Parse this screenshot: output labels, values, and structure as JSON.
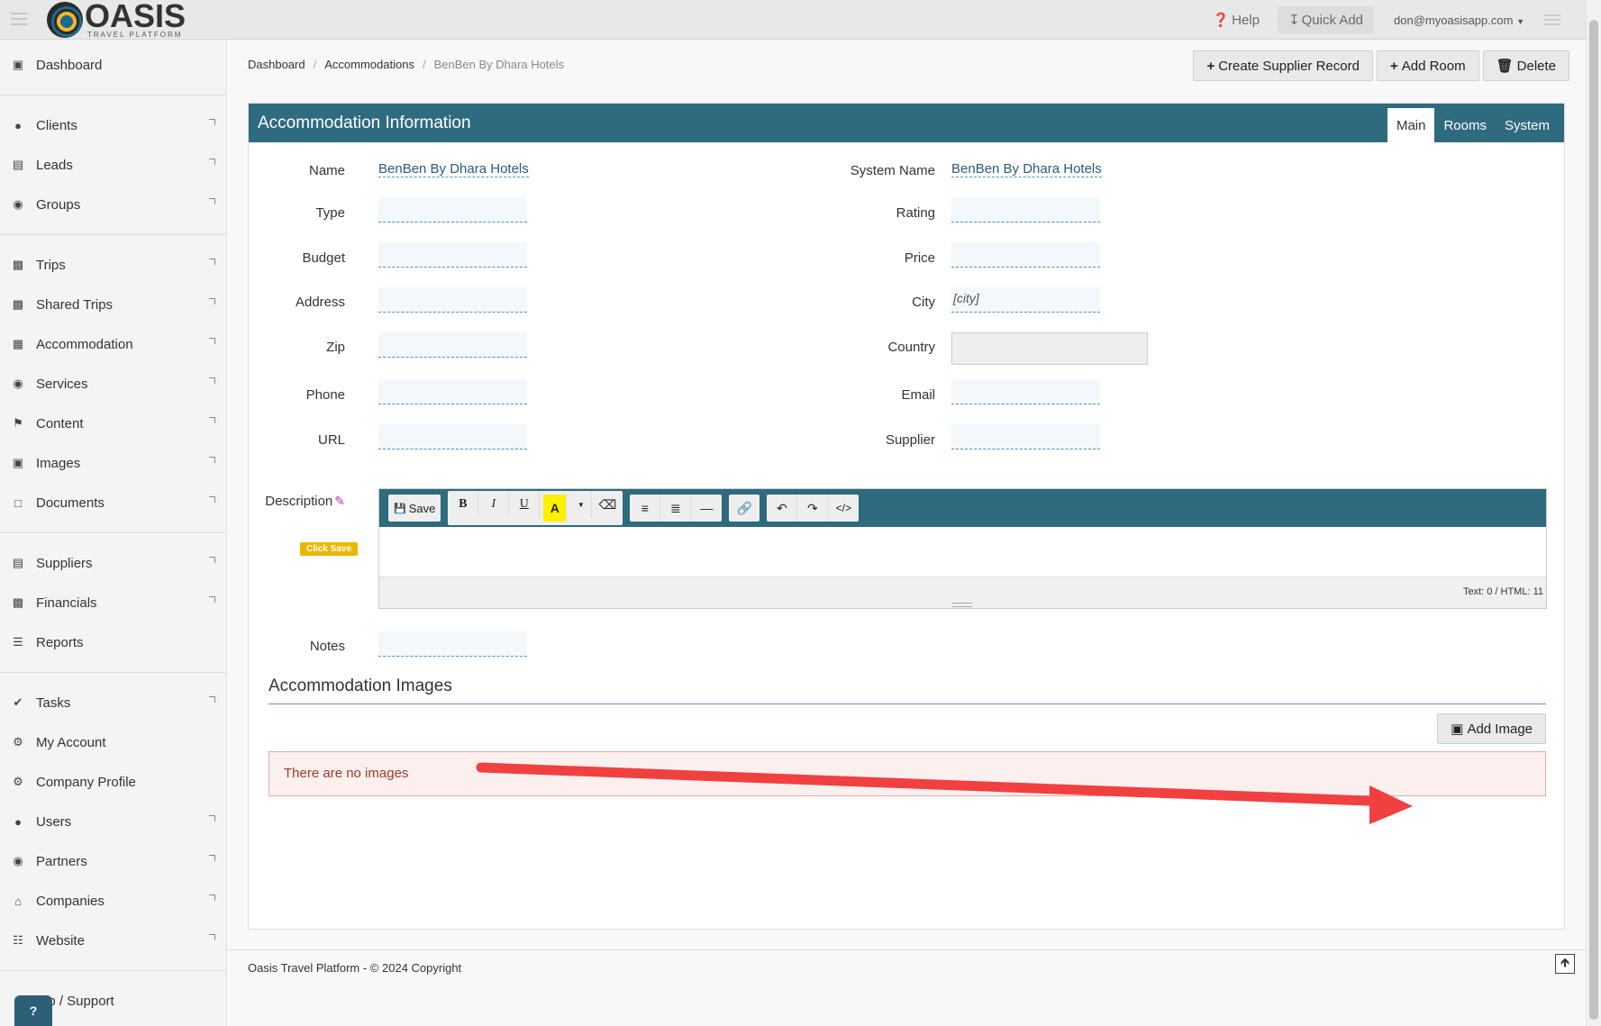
{
  "topbar": {
    "logo_title": "OASIS",
    "logo_sub": "TRAVEL PLATFORM",
    "help": "Help",
    "quick_add": "Quick Add",
    "user": "don@myoasisapp.com"
  },
  "sidebar": {
    "items": [
      {
        "label": "Dashboard",
        "icon": "monitor-icon"
      },
      {
        "label": "Clients",
        "icon": "user-icon"
      },
      {
        "label": "Leads",
        "icon": "inbox-icon"
      },
      {
        "label": "Groups",
        "icon": "users-icon"
      },
      {
        "label": "Trips",
        "icon": "suitcase-icon"
      },
      {
        "label": "Shared Trips",
        "icon": "suitcase-icon"
      },
      {
        "label": "Accommodation",
        "icon": "building-icon"
      },
      {
        "label": "Services",
        "icon": "binoculars-icon"
      },
      {
        "label": "Content",
        "icon": "flag-icon"
      },
      {
        "label": "Images",
        "icon": "image-icon"
      },
      {
        "label": "Documents",
        "icon": "pdf-icon"
      },
      {
        "label": "Suppliers",
        "icon": "server-icon"
      },
      {
        "label": "Financials",
        "icon": "money-icon"
      },
      {
        "label": "Reports",
        "icon": "list-icon"
      },
      {
        "label": "Tasks",
        "icon": "check-icon"
      },
      {
        "label": "My Account",
        "icon": "gear-icon"
      },
      {
        "label": "Company Profile",
        "icon": "gears-icon"
      },
      {
        "label": "Users",
        "icon": "user-icon"
      },
      {
        "label": "Partners",
        "icon": "users-icon"
      },
      {
        "label": "Companies",
        "icon": "bank-icon"
      },
      {
        "label": "Website",
        "icon": "sitemap-icon"
      }
    ],
    "help_support": "lp / Support",
    "help_bubble": "?"
  },
  "breadcrumb": {
    "dashboard": "Dashboard",
    "accommodations": "Accommodations",
    "current": "BenBen By Dhara Hotels"
  },
  "actions": {
    "create_supplier": "Create Supplier Record",
    "add_room": "Add Room",
    "delete": "Delete"
  },
  "panel": {
    "title": "Accommodation Information",
    "tabs": [
      "Main",
      "Rooms",
      "System"
    ]
  },
  "fields": {
    "name_label": "Name",
    "name_value": "BenBen By Dhara Hotels",
    "system_name_label": "System Name",
    "system_name_value": "BenBen By Dhara Hotels",
    "type_label": "Type",
    "rating_label": "Rating",
    "budget_label": "Budget",
    "price_label": "Price",
    "address_label": "Address",
    "city_label": "City",
    "city_value": "[city]",
    "zip_label": "Zip",
    "country_label": "Country",
    "phone_label": "Phone",
    "email_label": "Email",
    "url_label": "URL",
    "supplier_label": "Supplier",
    "description_label": "Description",
    "click_save": "Click Save",
    "notes_label": "Notes"
  },
  "editor": {
    "save": "Save",
    "bold": "B",
    "italic": "I",
    "underline": "U",
    "color": "A",
    "code": "</>",
    "count": "Text: 0 / HTML: 11"
  },
  "images": {
    "title": "Accommodation Images",
    "add_image": "Add Image",
    "empty": "There are no images"
  },
  "footer": {
    "copyright": "Oasis Travel Platform - © 2024 Copyright"
  },
  "colors": {
    "header": "#2e6b7f",
    "annotation_arrow": "#f04040"
  }
}
